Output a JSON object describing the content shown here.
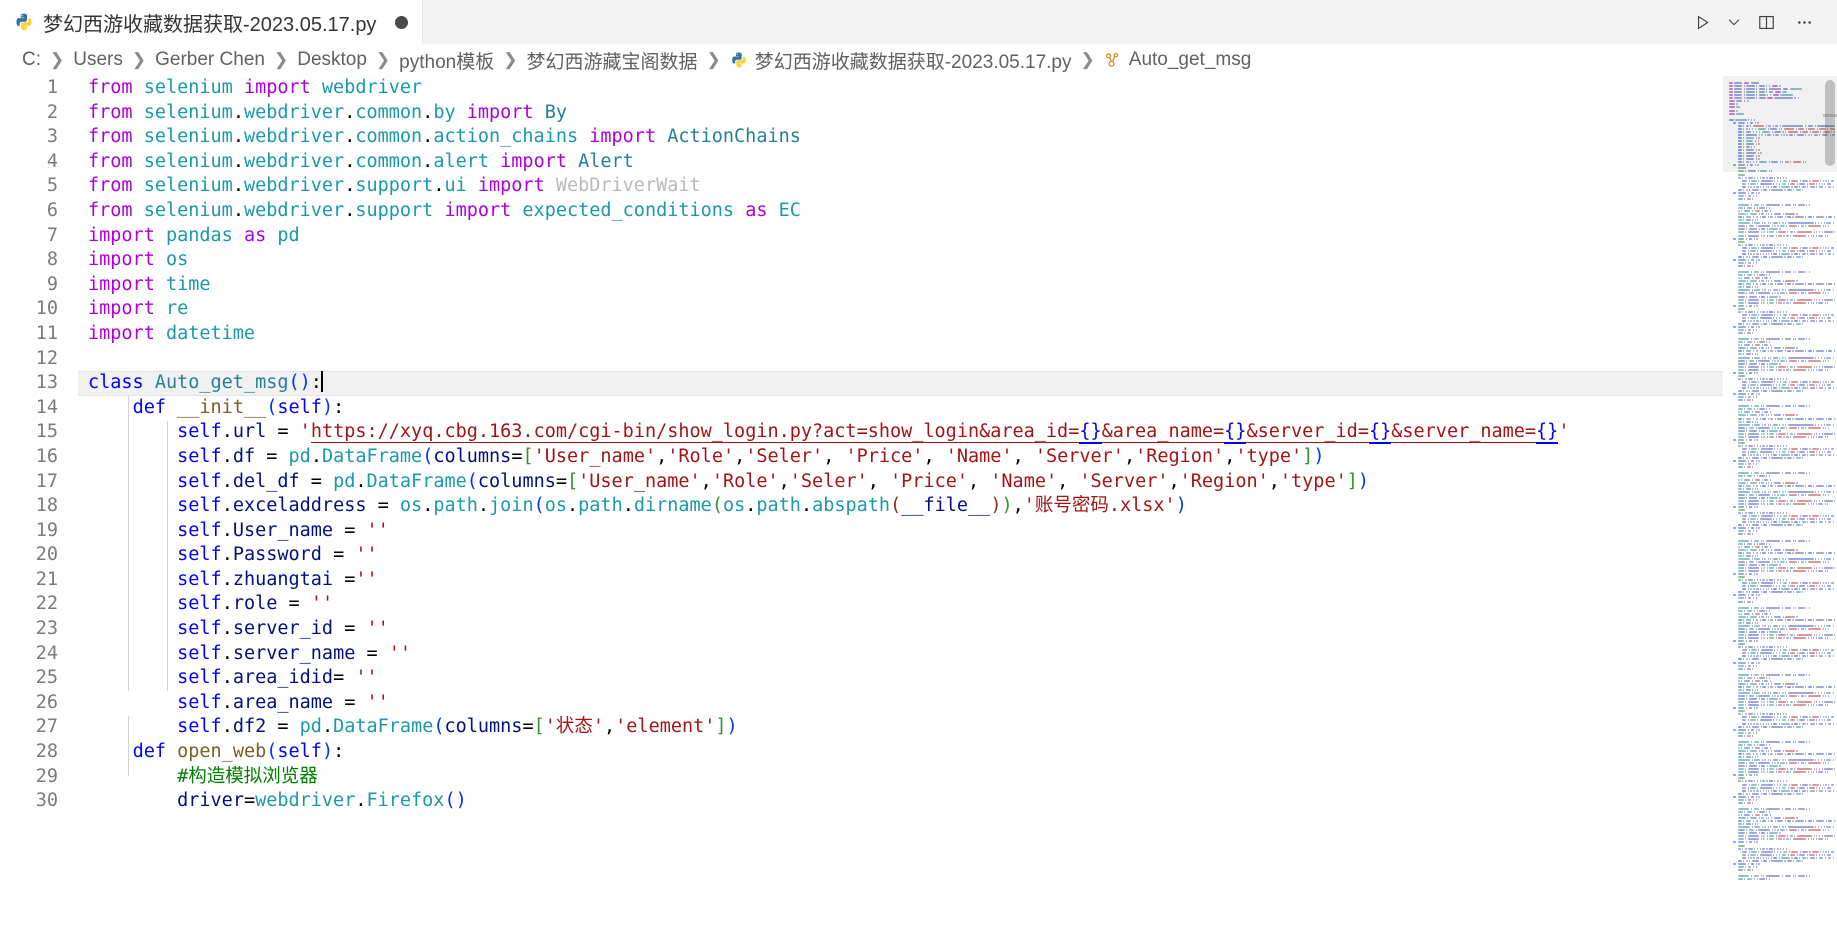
{
  "window": {
    "tab": {
      "icon": "python-file-icon",
      "title": "梦幻西游收藏数据获取-2023.05.17.py",
      "dirty_indicator": "●"
    },
    "actions": [
      {
        "name": "run-python-file-button",
        "icon": "play-triangle-icon",
        "label": "▷"
      },
      {
        "name": "run-options-dropdown",
        "icon": "chevron-down-icon",
        "label": "⌄"
      },
      {
        "name": "split-editor-right-button",
        "icon": "split-editor-icon",
        "label": "▥"
      },
      {
        "name": "more-actions-button",
        "icon": "ellipsis-icon",
        "label": "···"
      }
    ]
  },
  "breadcrumb": {
    "items": [
      {
        "label": "C:",
        "icon": null
      },
      {
        "label": "Users",
        "icon": null
      },
      {
        "label": "Gerber Chen",
        "icon": null
      },
      {
        "label": "Desktop",
        "icon": null
      },
      {
        "label": "python模板",
        "icon": null
      },
      {
        "label": "梦幻西游藏宝阁数据",
        "icon": null
      },
      {
        "label": "梦幻西游收藏数据获取-2023.05.17.py",
        "icon": "python-file-icon"
      },
      {
        "label": "Auto_get_msg",
        "icon": "class-symbol-icon"
      }
    ],
    "separator": "❯"
  },
  "editor": {
    "language": "python",
    "cursor_line": 13,
    "first_visible_line": 1,
    "last_visible_line": 30,
    "colors": {
      "keyword": "#0000ff",
      "import_keyword": "#af00db",
      "module": "#1a9aa8",
      "identifier": "#001080",
      "class_name": "#267f99",
      "function_name": "#795e26",
      "string": "#a31515",
      "comment": "#008000",
      "unused_import": "#b9b9b9",
      "current_line_bg": "#f1f1f1",
      "editor_bg": "#ffffff",
      "line_number": "#7b7b7b"
    },
    "lines": [
      {
        "n": 1,
        "text": "from selenium import webdriver"
      },
      {
        "n": 2,
        "text": "from selenium.webdriver.common.by import By"
      },
      {
        "n": 3,
        "text": "from selenium.webdriver.common.action_chains import ActionChains"
      },
      {
        "n": 4,
        "text": "from selenium.webdriver.common.alert import Alert"
      },
      {
        "n": 5,
        "text": "from selenium.webdriver.support.ui import WebDriverWait"
      },
      {
        "n": 6,
        "text": "from selenium.webdriver.support import expected_conditions as EC"
      },
      {
        "n": 7,
        "text": "import pandas as pd"
      },
      {
        "n": 8,
        "text": "import os"
      },
      {
        "n": 9,
        "text": "import time"
      },
      {
        "n": 10,
        "text": "import re"
      },
      {
        "n": 11,
        "text": "import datetime"
      },
      {
        "n": 12,
        "text": ""
      },
      {
        "n": 13,
        "text": "class Auto_get_msg():"
      },
      {
        "n": 14,
        "text": "    def __init__(self):"
      },
      {
        "n": 15,
        "text": "        self.url = 'https://xyq.cbg.163.com/cgi-bin/show_login.py?act=show_login&area_id={}&area_name={}&server_id={}&server_name={}'"
      },
      {
        "n": 16,
        "text": "        self.df = pd.DataFrame(columns=['User_name','Role','Seler', 'Price', 'Name', 'Server','Region','type'])"
      },
      {
        "n": 17,
        "text": "        self.del_df = pd.DataFrame(columns=['User_name','Role','Seler', 'Price', 'Name', 'Server','Region','type'])"
      },
      {
        "n": 18,
        "text": "        self.exceladdress = os.path.join(os.path.dirname(os.path.abspath(__file__)),'账号密码.xlsx')"
      },
      {
        "n": 19,
        "text": "        self.User_name = ''"
      },
      {
        "n": 20,
        "text": "        self.Password = ''"
      },
      {
        "n": 21,
        "text": "        self.zhuangtai =''"
      },
      {
        "n": 22,
        "text": "        self.role = ''"
      },
      {
        "n": 23,
        "text": "        self.server_id = ''"
      },
      {
        "n": 24,
        "text": "        self.server_name = ''"
      },
      {
        "n": 25,
        "text": "        self.area_idid= ''"
      },
      {
        "n": 26,
        "text": "        self.area_name = ''"
      },
      {
        "n": 27,
        "text": "        self.df2 = pd.DataFrame(columns=['状态','element'])"
      },
      {
        "n": 28,
        "text": "    def open_web(self):"
      },
      {
        "n": 29,
        "text": "        #构造模拟浏览器"
      },
      {
        "n": 30,
        "text": "        driver=webdriver.Firefox()"
      }
    ]
  },
  "minimap": {
    "name": "code-minimap",
    "viewport_top_percent": 0,
    "viewport_height_percent": 11
  }
}
